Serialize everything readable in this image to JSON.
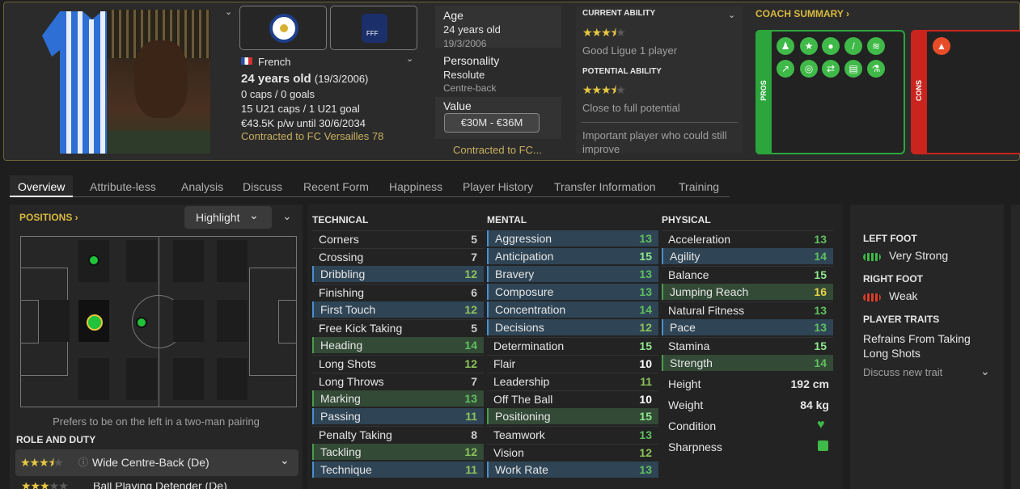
{
  "header": {
    "nationality": "French",
    "age_line": "24 years old",
    "dob_paren": "(19/3/2006)",
    "caps": "0 caps / 0 goals",
    "u21": "15 U21 caps / 1 U21 goal",
    "wage": "€43.5K p/w until 30/6/2034",
    "contract": "Contracted to FC Versailles 78",
    "age_label": "Age",
    "age_value": "24 years old",
    "dob": "19/3/2006",
    "personality_label": "Personality",
    "personality_value": "Resolute",
    "position_value": "Centre-back",
    "value_label": "Value",
    "value_range": "€30M - €36M",
    "contract_short": "Contracted to FC...",
    "current_ability_label": "CURRENT ABILITY",
    "current_ability_text": "Good Ligue 1 player",
    "current_ability_stars": 3.5,
    "potential_ability_label": "POTENTIAL ABILITY",
    "potential_ability_text": "Close to full potential",
    "potential_ability_stars": 3.5,
    "important_text": "Important player who could still improve",
    "coach_summary": "COACH SUMMARY ›",
    "pros_label": "PROS",
    "cons_label": "CONS"
  },
  "tabs": [
    "Overview",
    "Attribute-less",
    "Analysis",
    "Discuss",
    "Recent Form",
    "Happiness",
    "Player History",
    "Transfer Information",
    "Training"
  ],
  "positions": {
    "title": "POSITIONS ›",
    "highlight": "Highlight",
    "prefers": "Prefers to be on the left in a two-man pairing",
    "role_duty_label": "ROLE AND DUTY",
    "role": "Wide Centre-Back (De)",
    "role_stars": 3.5,
    "role2": "Ball Playing Defender (De)"
  },
  "technical": {
    "title": "TECHNICAL",
    "rows": [
      {
        "name": "Corners",
        "value": "5",
        "hl": ""
      },
      {
        "name": "Crossing",
        "value": "7",
        "hl": ""
      },
      {
        "name": "Dribbling",
        "value": "12",
        "hl": "b"
      },
      {
        "name": "Finishing",
        "value": "6",
        "hl": ""
      },
      {
        "name": "First Touch",
        "value": "12",
        "hl": "b"
      },
      {
        "name": "Free Kick Taking",
        "value": "5",
        "hl": ""
      },
      {
        "name": "Heading",
        "value": "14",
        "hl": "g"
      },
      {
        "name": "Long Shots",
        "value": "12",
        "hl": ""
      },
      {
        "name": "Long Throws",
        "value": "7",
        "hl": ""
      },
      {
        "name": "Marking",
        "value": "13",
        "hl": "g"
      },
      {
        "name": "Passing",
        "value": "11",
        "hl": "b"
      },
      {
        "name": "Penalty Taking",
        "value": "8",
        "hl": ""
      },
      {
        "name": "Tackling",
        "value": "12",
        "hl": "g"
      },
      {
        "name": "Technique",
        "value": "11",
        "hl": "b"
      }
    ]
  },
  "mental": {
    "title": "MENTAL",
    "rows": [
      {
        "name": "Aggression",
        "value": "13",
        "hl": "b"
      },
      {
        "name": "Anticipation",
        "value": "15",
        "hl": "b"
      },
      {
        "name": "Bravery",
        "value": "13",
        "hl": "b"
      },
      {
        "name": "Composure",
        "value": "13",
        "hl": "b"
      },
      {
        "name": "Concentration",
        "value": "14",
        "hl": "b"
      },
      {
        "name": "Decisions",
        "value": "12",
        "hl": "b"
      },
      {
        "name": "Determination",
        "value": "15",
        "hl": ""
      },
      {
        "name": "Flair",
        "value": "10",
        "hl": ""
      },
      {
        "name": "Leadership",
        "value": "11",
        "hl": ""
      },
      {
        "name": "Off The Ball",
        "value": "10",
        "hl": ""
      },
      {
        "name": "Positioning",
        "value": "15",
        "hl": "g"
      },
      {
        "name": "Teamwork",
        "value": "13",
        "hl": ""
      },
      {
        "name": "Vision",
        "value": "12",
        "hl": ""
      },
      {
        "name": "Work Rate",
        "value": "13",
        "hl": "b"
      }
    ]
  },
  "physical": {
    "title": "PHYSICAL",
    "rows": [
      {
        "name": "Acceleration",
        "value": "13",
        "hl": ""
      },
      {
        "name": "Agility",
        "value": "14",
        "hl": "b"
      },
      {
        "name": "Balance",
        "value": "15",
        "hl": ""
      },
      {
        "name": "Jumping Reach",
        "value": "16",
        "hl": "g"
      },
      {
        "name": "Natural Fitness",
        "value": "13",
        "hl": ""
      },
      {
        "name": "Pace",
        "value": "13",
        "hl": "b"
      },
      {
        "name": "Stamina",
        "value": "15",
        "hl": ""
      },
      {
        "name": "Strength",
        "value": "14",
        "hl": "g"
      }
    ],
    "height_label": "Height",
    "height": "192 cm",
    "weight_label": "Weight",
    "weight": "84 kg",
    "condition_label": "Condition",
    "sharpness_label": "Sharpness"
  },
  "feet": {
    "left_label": "LEFT FOOT",
    "left": "Very Strong",
    "right_label": "RIGHT FOOT",
    "right": "Weak",
    "traits_label": "PLAYER TRAITS",
    "trait": "Refrains From Taking Long Shots",
    "discuss": "Discuss new trait"
  },
  "colors": {
    "accent": "#d9b940",
    "pros": "#2ca63c",
    "cons": "#c9241e",
    "good": "#3fb948"
  }
}
